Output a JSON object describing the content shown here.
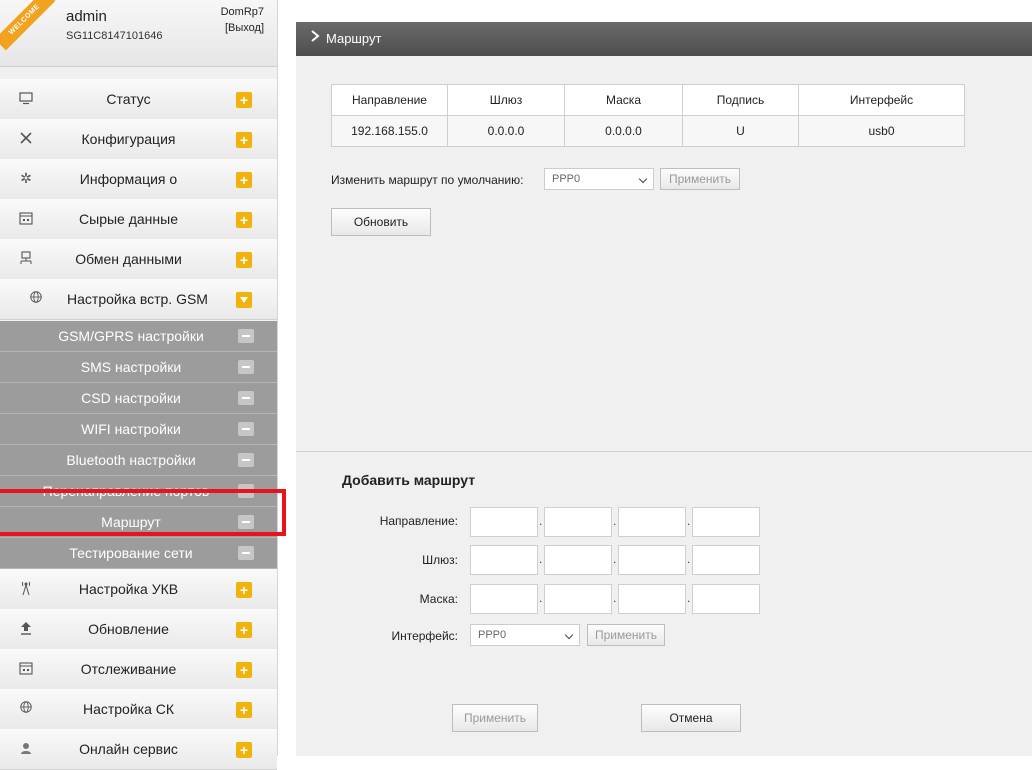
{
  "user": {
    "badge": "WELCOME",
    "name": "admin",
    "serial": "SG11C8147101646",
    "device": "DomRp7",
    "logout": "[Выход]"
  },
  "sidebar": {
    "items": [
      {
        "label": "Статус",
        "icon": "monitor-icon"
      },
      {
        "label": "Конфигурация",
        "icon": "tools-icon"
      },
      {
        "label": "Информация о",
        "icon": "info-star-icon"
      },
      {
        "label": "Сырые данные",
        "icon": "calendar-icon"
      },
      {
        "label": "Обмен данными",
        "icon": "network-icon"
      },
      {
        "label": "Настройка встр. GSM",
        "icon": "globe-icon",
        "expanded": true
      },
      {
        "label": "Настройка УКВ",
        "icon": "antenna-icon"
      },
      {
        "label": "Обновление",
        "icon": "upload-icon"
      },
      {
        "label": "Отслеживание",
        "icon": "calendar-icon"
      },
      {
        "label": "Настройка СК",
        "icon": "globe-icon"
      },
      {
        "label": "Онлайн сервис",
        "icon": "service-icon"
      }
    ],
    "subitems": [
      "GSM/GPRS настройки",
      "SMS настройки",
      "CSD настройки",
      "WIFI настройки",
      "Bluetooth настройки",
      "Перенаправление портов",
      "Маршрут",
      "Тестирование сети"
    ],
    "active_subitem": "Маршрут"
  },
  "header": {
    "title": "Маршрут"
  },
  "routes_table": {
    "columns": [
      "Направление",
      "Шлюз",
      "Маска",
      "Подпись",
      "Интерфейс"
    ],
    "rows": [
      [
        "192.168.155.0",
        "0.0.0.0",
        "0.0.0.0",
        "U",
        "usb0"
      ]
    ]
  },
  "default_route": {
    "label": "Изменить маршрут по умолчанию:",
    "value": "PPP0",
    "apply": "Применить"
  },
  "refresh_label": "Обновить",
  "add_route": {
    "title": "Добавить маршрут",
    "destination_label": "Направление:",
    "gateway_label": "Шлюз:",
    "mask_label": "Маска:",
    "interface_label": "Интерфейс:",
    "interface_value": "PPP0",
    "interface_apply": "Применить",
    "submit": "Применить",
    "cancel": "Отмена"
  },
  "colors": {
    "accent": "#f0b30c",
    "header_bg": "#5a5a5a",
    "submenu_bg": "#9c9c9c",
    "highlight": "#e8141c"
  }
}
